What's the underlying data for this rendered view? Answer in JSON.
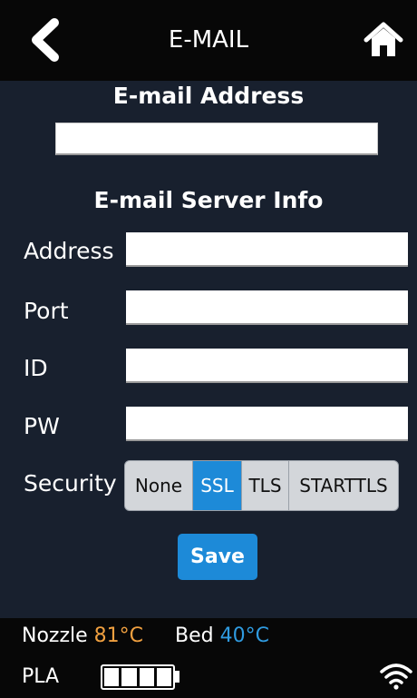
{
  "header": {
    "title": "E-MAIL"
  },
  "email": {
    "section_title": "E-mail Address",
    "value": ""
  },
  "server": {
    "section_title": "E-mail Server Info",
    "fields": [
      {
        "label": "Address",
        "value": ""
      },
      {
        "label": "Port",
        "value": ""
      },
      {
        "label": "ID",
        "value": ""
      },
      {
        "label": "PW",
        "value": ""
      }
    ],
    "security_label": "Security",
    "security_options": [
      "None",
      "SSL",
      "TLS",
      "STARTTLS"
    ],
    "security_selected": "SSL"
  },
  "save_label": "Save",
  "status": {
    "nozzle_label": "Nozzle",
    "nozzle_temp": "81°C",
    "bed_label": "Bed",
    "bed_temp": "40°C",
    "filament": "PLA",
    "battery_bars_filled": 4,
    "battery_bars_total": 4
  },
  "colors": {
    "accent": "#1d8ad8",
    "nozzle_temp": "#f0a040",
    "bed_temp": "#2f9be0",
    "background": "#18202e"
  }
}
